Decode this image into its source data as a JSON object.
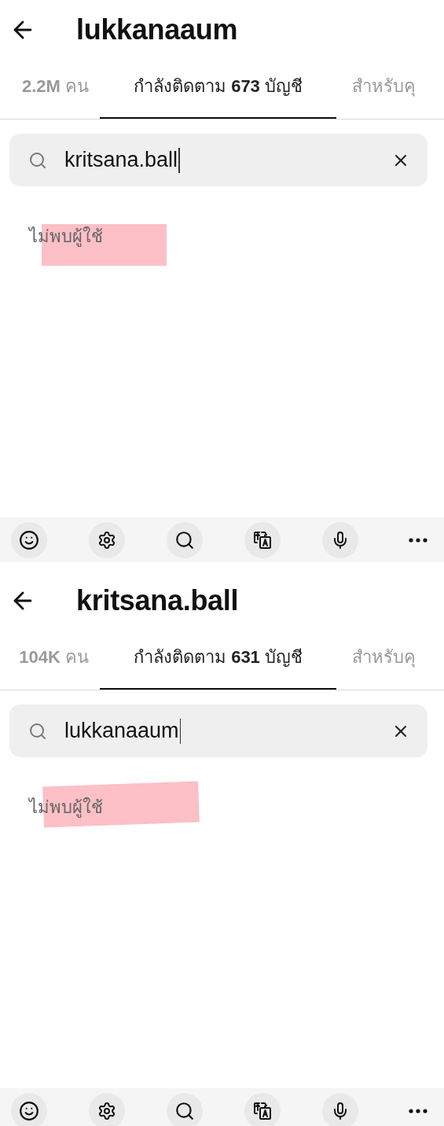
{
  "panels": [
    {
      "title": "lukkanaaum",
      "tabs": [
        {
          "label": "**2.2M** คน",
          "selected": false
        },
        {
          "label": "กำลังติดตาม **673** บัญชี",
          "selected": true
        },
        {
          "label": "สำหรับคุ",
          "selected": false
        }
      ],
      "search": {
        "value": "kritsana.ball",
        "focused": true
      },
      "message": "ไม่พบผู้ใช้",
      "highlighted": true
    },
    {
      "title": "kritsana.ball",
      "tabs": [
        {
          "label": "**104K** คน",
          "selected": false
        },
        {
          "label": "กำลังติดตาม **631** บัญชี",
          "selected": true
        },
        {
          "label": "สำหรับคุ",
          "selected": false
        }
      ],
      "search": {
        "value": "lukkanaaum",
        "focused": true
      },
      "message": "ไม่พบผู้ใช้",
      "highlighted": true
    }
  ]
}
